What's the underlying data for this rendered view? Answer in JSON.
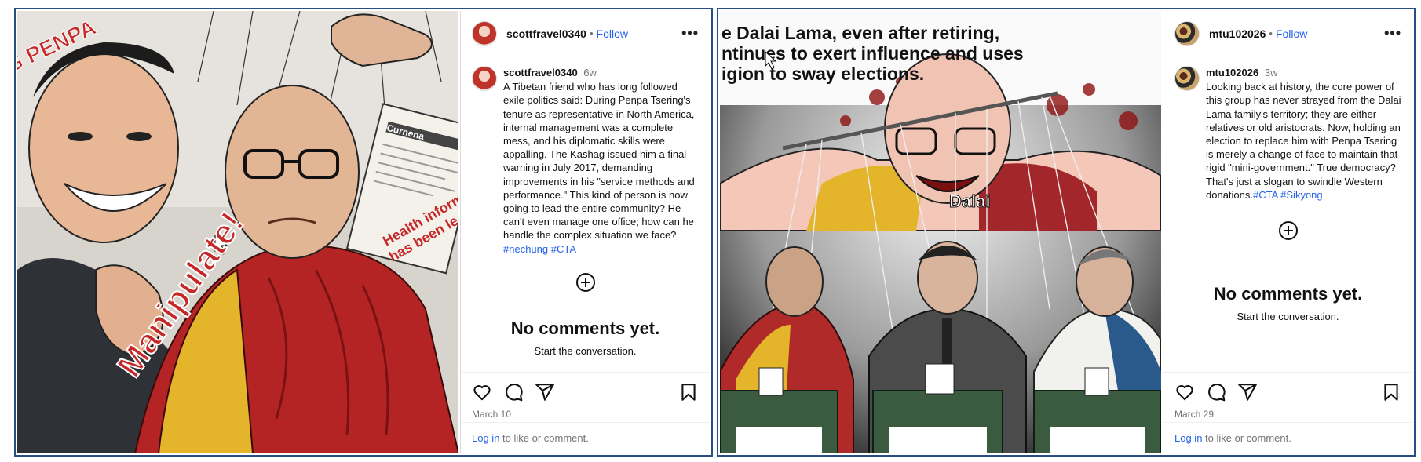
{
  "posts": [
    {
      "username": "scottfravel0340",
      "follow_label": "Follow",
      "separator": "•",
      "more_label": "•••",
      "time_ago": "6w",
      "caption": "A Tibetan friend who has long followed exile politics said: During Penpa Tsering's tenure as representative in North America, internal management was a complete mess, and his diplomatic skills were appalling. The Kashag issued him a final warning in July 2017, demanding improvements in his \"service methods and performance.\" This kind of person is now going to lead the entire community? He can't even manage one office; how can he handle the complex situation we face?",
      "hashtags": "#nechung #CTA",
      "no_comments": "No comments yet.",
      "start_conversation": "Start the conversation.",
      "date": "March 10",
      "login_link": "Log in",
      "login_suffix": " to like or comment.",
      "image_text": {
        "top_left": "G PENPA",
        "manipulate": "Manipulate!",
        "document_title": "Curr",
        "document_subtitle": "Curnena",
        "health_text_1": "Health inform",
        "health_text_2": "has been le"
      }
    },
    {
      "username": "mtu102026",
      "follow_label": "Follow",
      "separator": "•",
      "more_label": "•••",
      "time_ago": "3w",
      "caption": "Looking back at history, the core power of this group has never strayed from the Dalai Lama family's territory; they are either relatives or old aristocrats. Now, holding an election to replace him with Penpa Tsering is merely a change of face to maintain that rigid \"mini-government.\" True democracy? That's just a slogan to swindle Western donations.",
      "hashtags": "#CTA #Sikyong",
      "no_comments": "No comments yet.",
      "start_conversation": "Start the conversation.",
      "date": "March 29",
      "login_link": "Log in",
      "login_suffix": " to like or comment.",
      "image_text": {
        "line1": "e Dalai Lama, even after retiring,",
        "line2": "ntinues to exert influence and uses",
        "line3": "igion to sway elections.",
        "label": "Dalai"
      }
    }
  ],
  "colors": {
    "link_blue": "#2563eb",
    "panel_border": "#2a4f87",
    "muted": "#737373"
  }
}
